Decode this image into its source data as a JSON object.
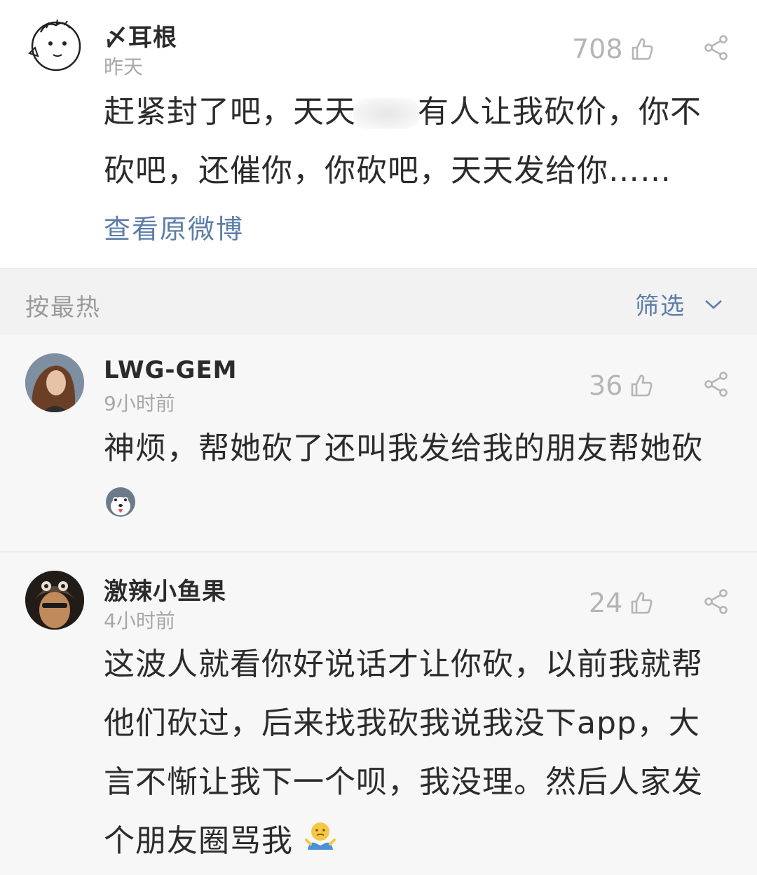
{
  "post": {
    "username": "〆耳根",
    "time": "昨天",
    "likes": "708",
    "text_before": "赶紧封了吧，天天",
    "text_after": "有人让我砍价，你不砍吧，还催你，你砍吧，天天发给你……",
    "view_original": "查看原微博"
  },
  "sortbar": {
    "sort_label": "按最热",
    "filter_label": "筛选"
  },
  "comments": [
    {
      "username": "LWG-GEM",
      "time": "9小时前",
      "likes": "36",
      "text": "神烦，帮她砍了还叫我发给我的朋友帮她砍"
    },
    {
      "username": "激辣小鱼果",
      "time": "4小时前",
      "likes": "24",
      "text": "这波人就看你好说话才让你砍，以前我就帮他们砍过，后来找我砍我说我没下app，大言不惭让我下一个呗，我没理。然后人家发个朋友圈骂我"
    }
  ],
  "icons": {
    "like": "thumbs-up-icon",
    "share": "share-icon",
    "filter": "chevron-down-icon"
  },
  "colors": {
    "link": "#5d7da8",
    "muted": "#a8a8a8"
  }
}
